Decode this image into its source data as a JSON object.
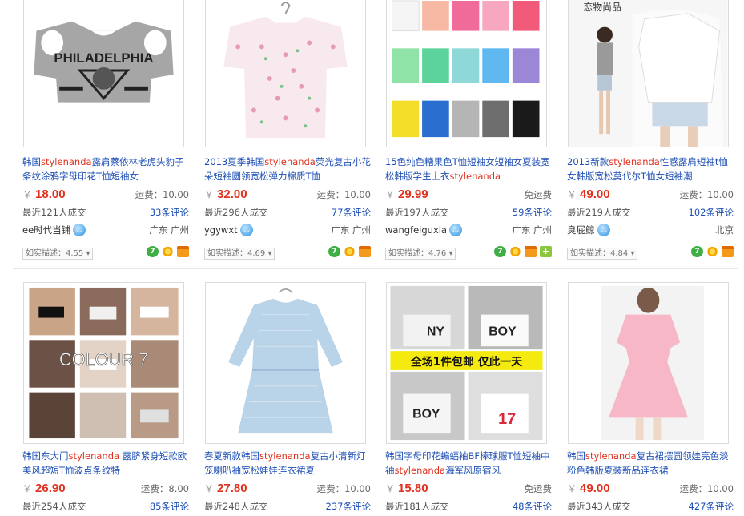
{
  "items": [
    {
      "title_pre": "韩国",
      "title_hl": "stylenanda",
      "title_post": "露肩蔡依林老虎头豹子条纹涂鸦字母印花T恤短袖女",
      "currency": "￥",
      "price": "18.00",
      "shipping": "运费：10.00",
      "sold": "最近121人成交",
      "reviews": "33条评论",
      "seller": "ee时代当铺",
      "location": "广东 广州",
      "desc": "如实描述：4.55",
      "image_text": "PHILADELPHIA",
      "badges": [
        "seven-icon",
        "flower-icon",
        "card-icon"
      ]
    },
    {
      "title_pre": "2013夏季韩国",
      "title_hl": "stylenanda",
      "title_post": "荧光复古小花朵短袖圆领宽松弹力棉质T恤",
      "currency": "￥",
      "price": "32.00",
      "shipping": "运费：10.00",
      "sold": "最近296人成交",
      "reviews": "77条评论",
      "seller": "ygywxt",
      "location": "广东 广州",
      "desc": "如实描述：4.69",
      "badges": [
        "seven-icon",
        "flower-icon",
        "card-icon"
      ]
    },
    {
      "title_pre": "15色纯色糖果色T恤短袖女短袖女夏装宽松韩版学生上衣",
      "title_hl": "stylenanda",
      "title_post": "",
      "currency": "￥",
      "price": "29.99",
      "shipping": "免运费",
      "sold": "最近197人成交",
      "reviews": "59条评论",
      "seller": "wangfeiguxia",
      "location": "广东 广州",
      "desc": "如实描述：4.76",
      "badges": [
        "seven-icon",
        "flower-icon",
        "card-icon",
        "plus-icon"
      ]
    },
    {
      "title_pre": "2013新款",
      "title_hl": "stylenanda",
      "title_post": "性感露肩短袖t恤女韩版宽松莫代尔T恤女短袖潮",
      "currency": "￥",
      "price": "49.00",
      "shipping": "运费：10.00",
      "sold": "最近219人成交",
      "reviews": "102条评论",
      "seller": "臭屁鲸",
      "location": "北京",
      "desc": "如实描述：4.84",
      "image_text": "恋物尚品",
      "badges": [
        "seven-icon",
        "flower-icon",
        "card-icon"
      ]
    },
    {
      "title_pre": "韩国东大门",
      "title_hl": "stylenanda",
      "title_post": " 露脐紧身短款欧美风超短T恤波点条纹特",
      "currency": "￥",
      "price": "26.90",
      "shipping": "运费：8.00",
      "sold": "最近254人成交",
      "reviews": "85条评论",
      "image_text": "COLOUR 7"
    },
    {
      "title_pre": "春夏新款韩国",
      "title_hl": "stylenanda",
      "title_post": "复古小清新灯笼喇叭袖宽松娃娃连衣裙夏",
      "currency": "￥",
      "price": "27.80",
      "shipping": "运费：10.00",
      "sold": "最近248人成交",
      "reviews": "237条评论"
    },
    {
      "title_pre": "韩国字母印花蝙蝠袖BF棒球服T恤短袖中袖",
      "title_hl": "stylenanda",
      "title_post": "海军风原宿风",
      "currency": "￥",
      "price": "15.80",
      "shipping": "免运费",
      "sold": "最近181人成交",
      "reviews": "48条评论",
      "image_text": "全场1件包邮  仅此一天"
    },
    {
      "title_pre": "韩国",
      "title_hl": "stylenanda",
      "title_post": "复古裙摆圆领娃亮色淡粉色韩版夏装新品连衣裙",
      "currency": "￥",
      "price": "49.00",
      "shipping": "运费：10.00",
      "sold": "最近343人成交",
      "reviews": "427条评论"
    }
  ],
  "colors": {
    "link": "#1e4fb5",
    "highlight": "#e0301e",
    "price": "#e0301e"
  }
}
